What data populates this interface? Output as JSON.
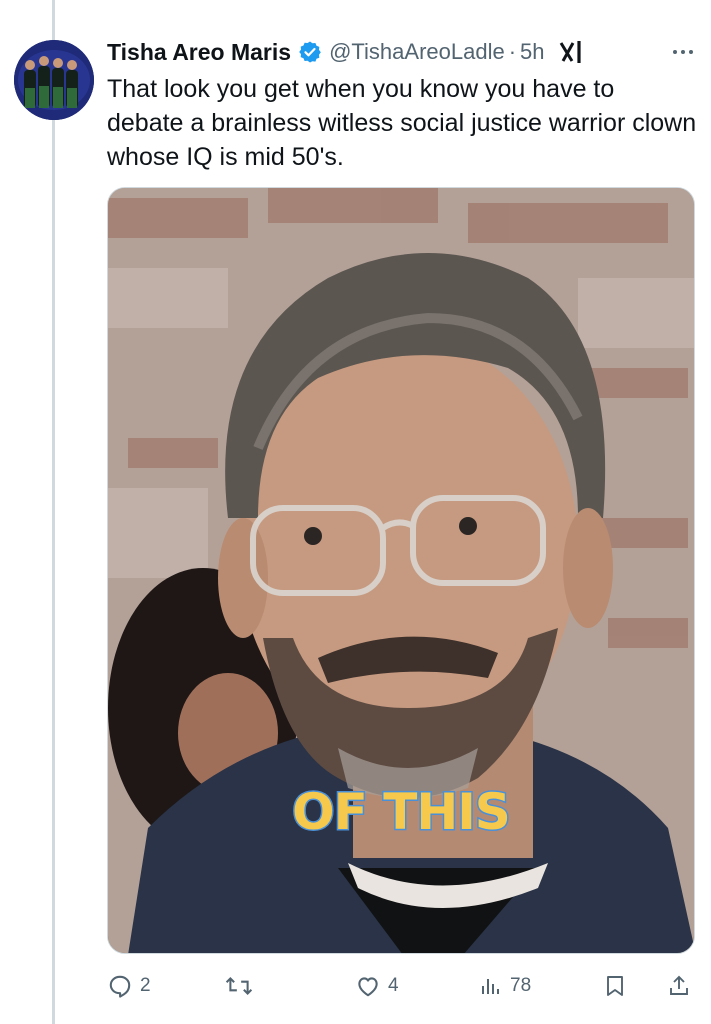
{
  "tweet": {
    "author_name": "Tisha Areo Maris",
    "handle": "@TishaAreoLadle",
    "separator": "·",
    "time": "5h",
    "text": "That look you get when you know you have to debate a brainless witless social justice warrior clown whose IQ is mid 50's.",
    "media_caption": "OF THIS"
  },
  "actions": {
    "replies": "2",
    "reposts": "",
    "likes": "4",
    "views": "78"
  },
  "icons": {
    "verified": "verified-badge-icon",
    "grok": "grok-icon",
    "more": "more-icon",
    "reply": "reply-icon",
    "repost": "repost-icon",
    "like": "heart-icon",
    "views": "views-icon",
    "bookmark": "bookmark-icon",
    "share": "share-icon"
  },
  "colors": {
    "verified_blue": "#1d9bf0",
    "secondary_text": "#536471",
    "caption_fill": "#f6c94c",
    "caption_stroke": "#4a90d9"
  }
}
